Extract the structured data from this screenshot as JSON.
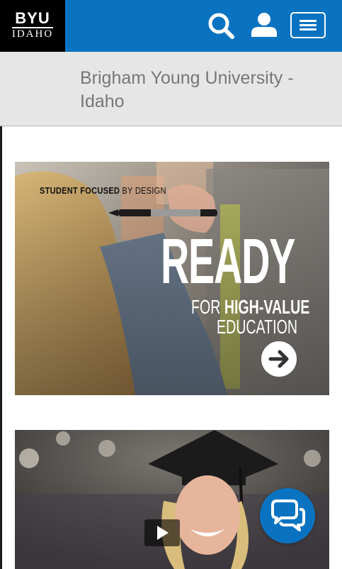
{
  "header": {
    "logo_top": "BYU",
    "logo_bottom": "IDAHO",
    "bg_color": "#0a73c1",
    "icons": [
      "search-icon",
      "user-icon",
      "hamburger-menu-icon"
    ]
  },
  "title_bar": {
    "title": "Brigham Young University - Idaho"
  },
  "banners": [
    {
      "tagline_bold": "STUDENT FOCUSED",
      "tagline_rest": "BY DESIGN",
      "headline": "READY",
      "sub_prefix": "FOR",
      "sub_bold": "HIGH-VALUE",
      "sub_line2": "EDUCATION",
      "icon": "arrow-right-circle-icon"
    },
    {
      "icon": "play-icon"
    }
  ],
  "chat": {
    "icon": "chat-bubbles-icon",
    "color": "#0a73c1"
  }
}
